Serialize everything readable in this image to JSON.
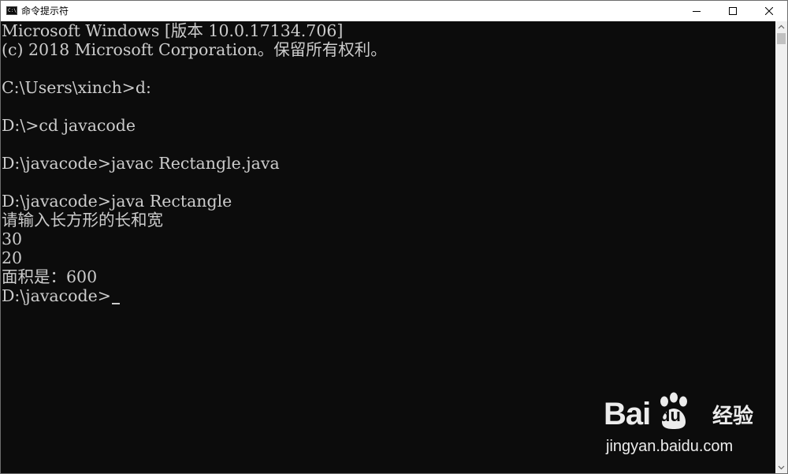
{
  "window": {
    "title": "命令提示符",
    "icon_text": "C:\\",
    "controls": {
      "minimize_icon": "minimize-icon",
      "maximize_icon": "maximize-icon",
      "close_icon": "close-icon"
    }
  },
  "console": {
    "background_color": "#0c0c0c",
    "text_color": "#cccccc",
    "lines": [
      "Microsoft Windows [版本 10.0.17134.706]",
      "(c) 2018 Microsoft Corporation。保留所有权利。",
      "",
      "C:\\Users\\xinch>d:",
      "",
      "D:\\>cd javacode",
      "",
      "D:\\javacode>javac Rectangle.java",
      "",
      "D:\\javacode>java Rectangle",
      "请输入长方形的长和宽",
      "30",
      "20",
      "面积是：600",
      "D:\\javacode>"
    ]
  },
  "watermark": {
    "brand_left": "Bai",
    "brand_right": "du",
    "product": "经验",
    "url": "jingyan.baidu.com"
  }
}
